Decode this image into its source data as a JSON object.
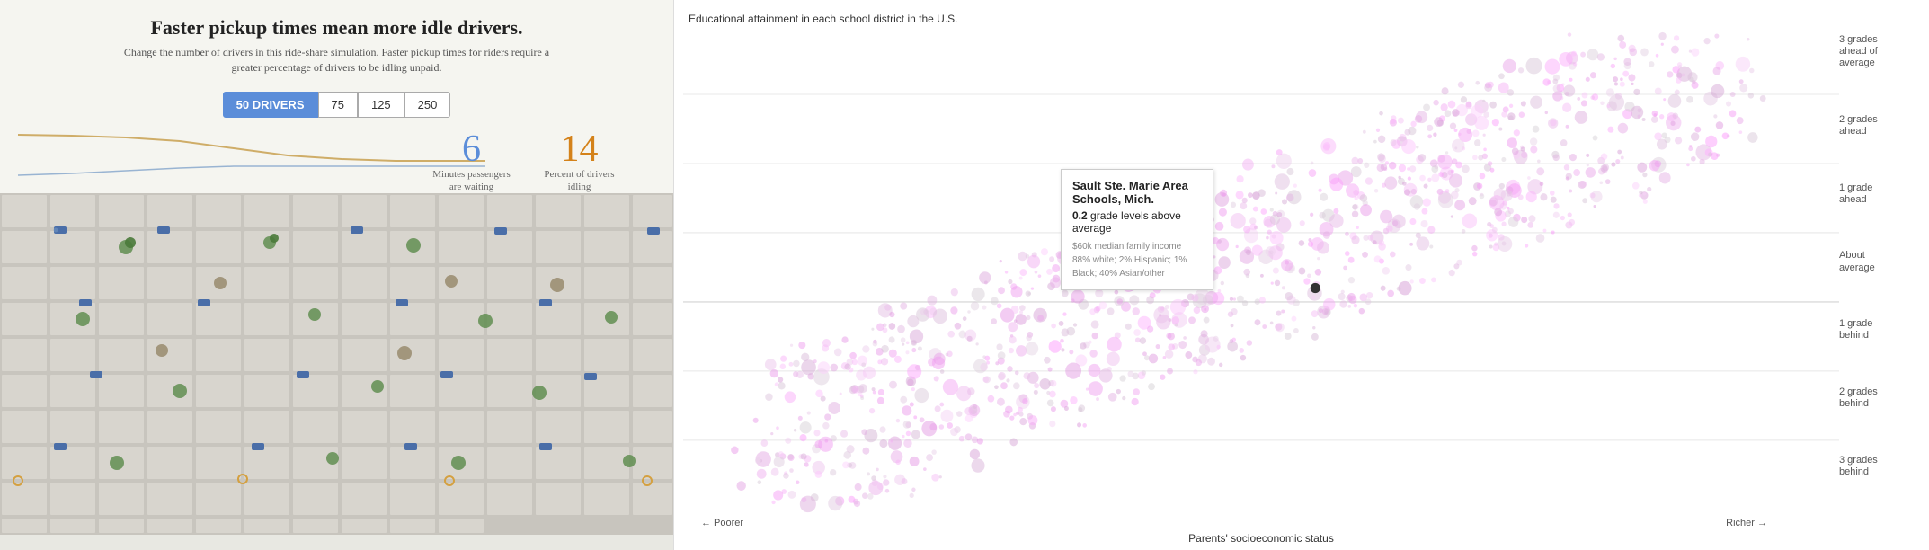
{
  "left": {
    "title": "Faster pickup times mean more idle drivers.",
    "subtitle": "Change the number of drivers in this ride-share simulation. Faster pickup times for riders require a greater percentage of drivers to be idling unpaid.",
    "buttons": [
      {
        "label": "50 DRIVERS",
        "active": true
      },
      {
        "label": "75",
        "active": false
      },
      {
        "label": "125",
        "active": false
      },
      {
        "label": "250",
        "active": false
      }
    ],
    "stat1": {
      "number": "6",
      "label": "Minutes passengers are waiting",
      "color": "blue"
    },
    "stat2": {
      "number": "14",
      "label": "Percent of drivers idling",
      "color": "orange"
    }
  },
  "right": {
    "chart_title": "Educational attainment in each school district in the U.S.",
    "y_labels": [
      {
        "text": "3 grades\nahead of\naverage"
      },
      {
        "text": "2 grades\nahead"
      },
      {
        "text": "1 grade\nahead"
      },
      {
        "text": "About\naverage"
      },
      {
        "text": "1 grade\nbehind"
      },
      {
        "text": "2 grades\nbehind"
      },
      {
        "text": "3 grades\nbehind"
      }
    ],
    "x_left": "← Poorer",
    "x_center": "Parents' socioeconomic status",
    "x_right": "Richer →",
    "tooltip": {
      "school": "Sault Ste. Marie Area Schools, Mich.",
      "grade_text": "0.2",
      "grade_suffix": " grade levels above average",
      "detail1": "$60k median family income",
      "detail2": "88% white; 2% Hispanic; 1% Black; 40% Asian/other"
    }
  }
}
